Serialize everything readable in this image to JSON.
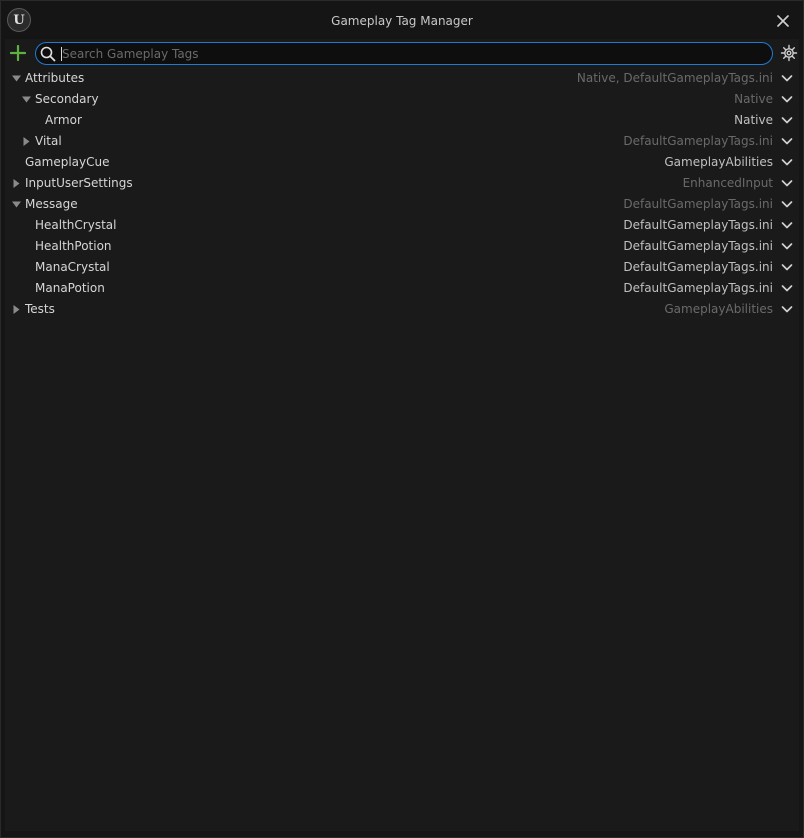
{
  "window": {
    "title": "Gameplay Tag Manager",
    "logo_glyph": "U"
  },
  "search": {
    "placeholder": "Search Gameplay Tags",
    "value": ""
  },
  "colors": {
    "accent_blue": "#1e7bd3",
    "add_green": "#5fb043",
    "background": "#1a1a1a"
  },
  "tags": [
    {
      "label": "Attributes",
      "source": "Native, DefaultGameplayTags.ini",
      "expanded": true,
      "has_children": true,
      "depth": 0,
      "source_style": "dim"
    },
    {
      "label": "Secondary",
      "source": "Native",
      "expanded": true,
      "has_children": true,
      "depth": 1,
      "source_style": "dim"
    },
    {
      "label": "Armor",
      "source": "Native",
      "expanded": false,
      "has_children": false,
      "depth": 2,
      "source_style": "bright"
    },
    {
      "label": "Vital",
      "source": "DefaultGameplayTags.ini",
      "expanded": false,
      "has_children": true,
      "depth": 1,
      "source_style": "dim"
    },
    {
      "label": "GameplayCue",
      "source": "GameplayAbilities",
      "expanded": false,
      "has_children": false,
      "depth": 0,
      "source_style": "bright"
    },
    {
      "label": "InputUserSettings",
      "source": "EnhancedInput",
      "expanded": false,
      "has_children": true,
      "depth": 0,
      "source_style": "dim"
    },
    {
      "label": "Message",
      "source": "DefaultGameplayTags.ini",
      "expanded": true,
      "has_children": true,
      "depth": 0,
      "source_style": "dim"
    },
    {
      "label": "HealthCrystal",
      "source": "DefaultGameplayTags.ini",
      "expanded": false,
      "has_children": false,
      "depth": 1,
      "source_style": "bright"
    },
    {
      "label": "HealthPotion",
      "source": "DefaultGameplayTags.ini",
      "expanded": false,
      "has_children": false,
      "depth": 1,
      "source_style": "bright"
    },
    {
      "label": "ManaCrystal",
      "source": "DefaultGameplayTags.ini",
      "expanded": false,
      "has_children": false,
      "depth": 1,
      "source_style": "bright"
    },
    {
      "label": "ManaPotion",
      "source": "DefaultGameplayTags.ini",
      "expanded": false,
      "has_children": false,
      "depth": 1,
      "source_style": "bright"
    },
    {
      "label": "Tests",
      "source": "GameplayAbilities",
      "expanded": false,
      "has_children": true,
      "depth": 0,
      "source_style": "dim"
    }
  ]
}
